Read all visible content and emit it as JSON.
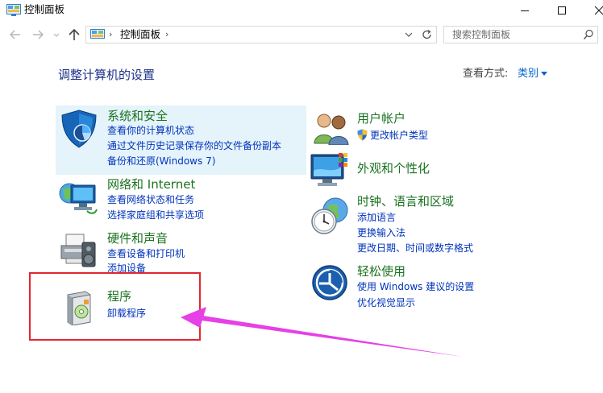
{
  "window": {
    "title": "控制面板"
  },
  "address": {
    "crumb_sep": "›",
    "path": "控制面板",
    "trail_sep": "›"
  },
  "search": {
    "placeholder": "搜索控制面板"
  },
  "header": {
    "title": "调整计算机的设置",
    "view_label": "查看方式:",
    "view_value": "类别"
  },
  "categories_left": [
    {
      "title": "系统和安全",
      "links": [
        "查看你的计算机状态",
        "通过文件历史记录保存你的文件备份副本",
        "备份和还原(Windows 7)"
      ]
    },
    {
      "title": "网络和 Internet",
      "links": [
        "查看网络状态和任务",
        "选择家庭组和共享选项"
      ]
    },
    {
      "title": "硬件和声音",
      "links": [
        "查看设备和打印机",
        "添加设备"
      ]
    },
    {
      "title": "程序",
      "links": [
        "卸载程序"
      ]
    }
  ],
  "categories_right": [
    {
      "title": "用户帐户",
      "links": [
        "更改帐户类型"
      ]
    },
    {
      "title": "外观和个性化",
      "links": []
    },
    {
      "title": "时钟、语言和区域",
      "links": [
        "添加语言",
        "更换输入法",
        "更改日期、时间或数字格式"
      ]
    },
    {
      "title": "轻松使用",
      "links": [
        "使用 Windows 建议的设置",
        "优化视觉显示"
      ]
    }
  ],
  "colors": {
    "category_title": "#1a7320",
    "link": "#0033bb",
    "highlight": "#e5f3fb",
    "annotation_box": "#e3262f",
    "annotation_arrow": "#e640e6"
  }
}
